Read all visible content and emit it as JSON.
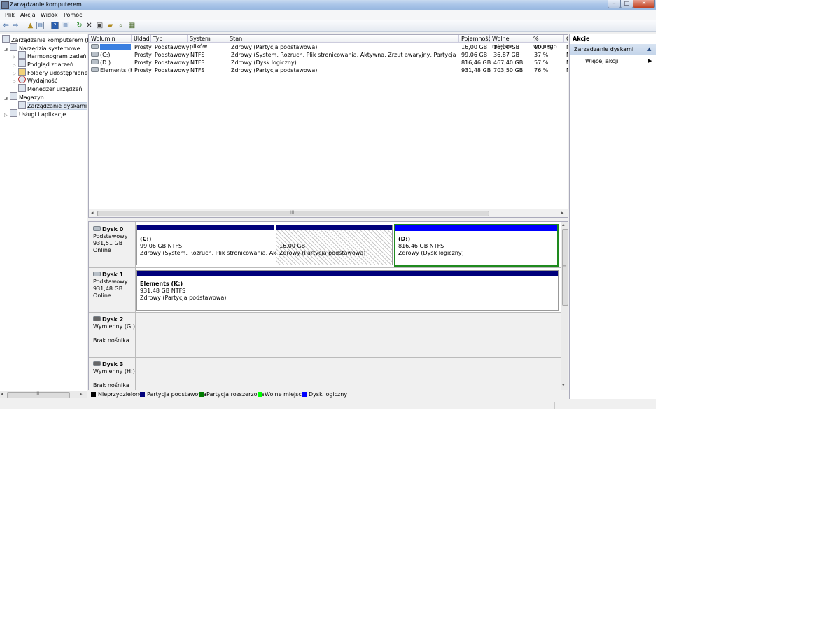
{
  "window": {
    "title": "Zarządzanie komputerem",
    "controls": {
      "minimize": "–",
      "maximize": "□",
      "close": "✕"
    }
  },
  "menu": [
    "Plik",
    "Akcja",
    "Widok",
    "Pomoc"
  ],
  "toolbar": {
    "icons": [
      "back-arrow-icon",
      "forward-arrow-icon",
      "up-folder-icon",
      "show-hide-tree-icon",
      "help-icon",
      "view-icon",
      "refresh-icon",
      "delete-icon",
      "properties-icon",
      "open-icon",
      "search-icon",
      "export-icon"
    ]
  },
  "tree": {
    "items": [
      {
        "label": "Zarządzanie komputerem (loka",
        "expand": ""
      },
      {
        "label": "Narzędzia systemowe",
        "expand": "◢"
      },
      {
        "label": "Harmonogram zadań",
        "expand": "▷"
      },
      {
        "label": "Podgląd zdarzeń",
        "expand": "▷"
      },
      {
        "label": "Foldery udostępnione",
        "expand": "▷"
      },
      {
        "label": "Wydajność",
        "expand": "▷"
      },
      {
        "label": "Menedżer urządzeń",
        "expand": ""
      },
      {
        "label": "Magazyn",
        "expand": "◢"
      },
      {
        "label": "Zarządzanie dyskami",
        "expand": ""
      },
      {
        "label": "Usługi i aplikacje",
        "expand": "▷"
      }
    ],
    "hscroll_thumb": "III",
    "hscroll_left": "◂",
    "hscroll_right": "▸"
  },
  "volumes": {
    "headers": [
      "Wolumin",
      "Układ",
      "Typ",
      "System plików",
      "Stan",
      "Pojemność",
      "Wolne miejsce",
      "% wolnego",
      "C"
    ],
    "rows": [
      {
        "name": "",
        "layout": "Prosty",
        "type": "Podstawowy",
        "fs": "",
        "status": "Zdrowy (Partycja podstawowa)",
        "capacity": "16,00 GB",
        "free": "16,00 GB",
        "pct": "100 %",
        "extra": "N"
      },
      {
        "name": "(C:)",
        "layout": "Prosty",
        "type": "Podstawowy",
        "fs": "NTFS",
        "status": "Zdrowy (System, Rozruch, Plik stronicowania, Aktywna, Zrzut awaryjny, Partycja podstawowa)",
        "capacity": "99,06 GB",
        "free": "36,87 GB",
        "pct": "37 %",
        "extra": "N"
      },
      {
        "name": "(D:)",
        "layout": "Prosty",
        "type": "Podstawowy",
        "fs": "NTFS",
        "status": "Zdrowy (Dysk logiczny)",
        "capacity": "816,46 GB",
        "free": "467,40 GB",
        "pct": "57 %",
        "extra": "N"
      },
      {
        "name": "Elements (K:)",
        "layout": "Prosty",
        "type": "Podstawowy",
        "fs": "NTFS",
        "status": "Zdrowy (Partycja podstawowa)",
        "capacity": "931,48 GB",
        "free": "703,50 GB",
        "pct": "76 %",
        "extra": "N"
      }
    ],
    "hscroll_thumb": "III",
    "hscroll_left": "◂",
    "hscroll_right": "▸"
  },
  "disks": [
    {
      "name": "Dysk 0",
      "kind": "Podstawowy",
      "size": "931,51 GB",
      "state": "Online",
      "partitions": [
        {
          "title": "(C:)",
          "size": "99,06 GB NTFS",
          "status": "Zdrowy (System, Rozruch, Plik stronicowania, Aktywna,"
        },
        {
          "title": "",
          "size": "16,00 GB",
          "status": "Zdrowy (Partycja podstawowa)"
        },
        {
          "title": "(D:)",
          "size": "816,46 GB NTFS",
          "status": "Zdrowy (Dysk logiczny)"
        }
      ]
    },
    {
      "name": "Dysk 1",
      "kind": "Podstawowy",
      "size": "931,48 GB",
      "state": "Online",
      "partitions": [
        {
          "title": "Elements  (K:)",
          "size": "931,48 GB NTFS",
          "status": "Zdrowy (Partycja podstawowa)"
        }
      ]
    },
    {
      "name": "Dysk 2",
      "kind": "Wymienny (G:)",
      "state": "Brak nośnika"
    },
    {
      "name": "Dysk 3",
      "kind": "Wymienny (H:)",
      "state": "Brak nośnika"
    }
  ],
  "disk_vscroll": {
    "up": "▴",
    "down": "▾",
    "grip": "≡"
  },
  "legend": [
    {
      "label": "Nieprzydzielone",
      "color": "#000000"
    },
    {
      "label": "Partycja podstawowa",
      "color": "#00007b"
    },
    {
      "label": "Partycja rozszerzona",
      "color": "#007b00"
    },
    {
      "label": "Wolne miejsce",
      "color": "#00ff00"
    },
    {
      "label": "Dysk logiczny",
      "color": "#0000ff"
    }
  ],
  "actions": {
    "title": "Akcje",
    "section": "Zarządzanie dyskami",
    "section_arrow": "▲",
    "more": "Więcej akcji",
    "more_arrow": "▶"
  },
  "colors": {
    "primary_partition": "#00007b",
    "logical_drive": "#0000ff",
    "selection_border": "#1e8a1e"
  }
}
